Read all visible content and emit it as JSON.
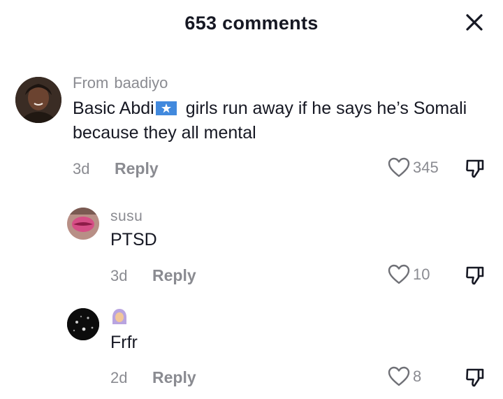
{
  "header": {
    "title": "653 comments"
  },
  "comments": [
    {
      "from_label": "From",
      "username": "baadiyo",
      "text_before_flag": "Basic Abdi",
      "text_after_flag": " girls run away if he says he’s Somali because they all mental",
      "time": "3d",
      "reply_label": "Reply",
      "likes": "345"
    },
    {
      "username": "susu",
      "text": "PTSD",
      "time": "3d",
      "reply_label": "Reply",
      "likes": "10"
    },
    {
      "username_icon": "hijab-woman-emoji",
      "text": "Frfr",
      "time": "2d",
      "reply_label": "Reply",
      "likes": "8"
    }
  ],
  "icons": {
    "close": "close-icon",
    "like": "heart-icon",
    "dislike": "thumbs-down-icon",
    "flag": "somalia-flag-icon"
  },
  "colors": {
    "text": "#161823",
    "muted": "#8a8b91",
    "flag_blue": "#4189dd"
  }
}
